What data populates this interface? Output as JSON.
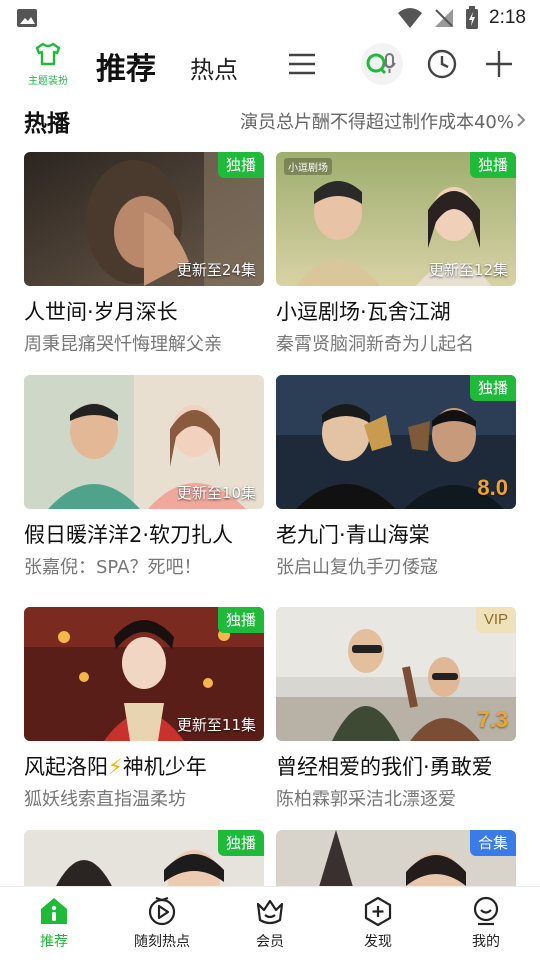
{
  "status_bar": {
    "time": "2:18"
  },
  "top_nav": {
    "theme_label": "主题装扮",
    "tab_recommend": "推荐",
    "tab_hot": "热点"
  },
  "section": {
    "title": "热播",
    "link_text": "演员总片酬不得超过制作成本40%"
  },
  "cards": [
    {
      "title": "人世间·岁月深长",
      "subtitle": "周秉昆痛哭忏悔理解父亲",
      "badge": "独播",
      "episode": "更新至24集"
    },
    {
      "title": "小逗剧场·瓦舍江湖",
      "subtitle": "秦霄贤脑洞新奇为儿起名",
      "badge": "独播",
      "episode": "更新至12集",
      "logo_text": "小逗剧场"
    },
    {
      "title": "假日暖洋洋2·软刀扎人",
      "subtitle": "张嘉倪：SPA？死吧！",
      "episode": "更新至10集"
    },
    {
      "title": "老九门·青山海棠",
      "subtitle": "张启山复仇手刃倭寇",
      "badge": "独播",
      "score": "8.0"
    },
    {
      "title_pre": "风起洛阳",
      "title_icon": "⚡",
      "title_post": "神机少年",
      "subtitle": "狐妖线索直指温柔坊",
      "badge": "独播",
      "episode": "更新至11集"
    },
    {
      "title": "曾经相爱的我们·勇敢爱",
      "subtitle": "陈柏霖郭采洁北漂逐爱",
      "badge": "VIP",
      "score": "7.3"
    },
    {
      "badge": "独播"
    },
    {
      "badge": "合集"
    }
  ],
  "bottom_nav": {
    "items": [
      {
        "label": "推荐",
        "icon": "home-icon"
      },
      {
        "label": "随刻热点",
        "icon": "play-circle-icon"
      },
      {
        "label": "会员",
        "icon": "crown-icon"
      },
      {
        "label": "发现",
        "icon": "plus-circle-icon"
      },
      {
        "label": "我的",
        "icon": "profile-icon"
      }
    ]
  },
  "colors": {
    "accent": "#1fba3a",
    "score": "#f2a32a",
    "vip_bg": "#f0e2b8",
    "collection_bg": "#3b7be8"
  }
}
